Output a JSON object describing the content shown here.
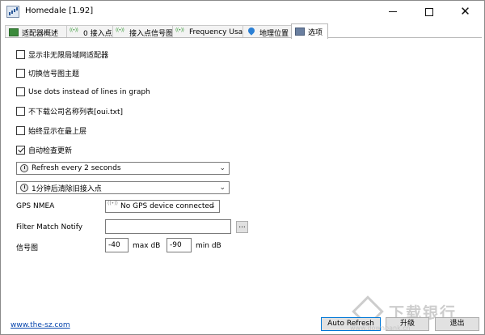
{
  "window": {
    "title": "Homedale [1.92]"
  },
  "tabs": [
    {
      "label": "适配器概述",
      "icon": "adapter-icon"
    },
    {
      "label": "0 接入点",
      "icon": "signal-icon"
    },
    {
      "label": "接入点信号图",
      "icon": "signal-icon"
    },
    {
      "label": "Frequency Usage",
      "icon": "signal-icon"
    },
    {
      "label": "地理位置",
      "icon": "pin-icon"
    },
    {
      "label": "选项",
      "icon": "options-icon",
      "active": true
    }
  ],
  "options": {
    "show_non_wlan": {
      "label": "显示非无限局域网适配器",
      "checked": false
    },
    "switch_theme": {
      "label": "切换信号图主题",
      "checked": false
    },
    "use_dots": {
      "label": "Use dots instead of lines in graph",
      "checked": false
    },
    "no_download_oui": {
      "label": "不下载公司名称列表[oui.txt]",
      "checked": false
    },
    "always_on_top": {
      "label": "始终显示在最上层",
      "checked": false
    },
    "auto_update": {
      "label": "自动检查更新",
      "checked": true
    }
  },
  "refresh_select": {
    "value": "Refresh every 2 seconds"
  },
  "clear_select": {
    "value": "1分钟后清除旧接入点"
  },
  "gps": {
    "label": "GPS NMEA",
    "value": "No GPS device connected"
  },
  "filter": {
    "label": "Filter Match Notify",
    "value": "",
    "browse_label": "..."
  },
  "signal_graph": {
    "label": "信号图",
    "max_value": "-40",
    "max_unit": "max dB",
    "min_value": "-90",
    "min_unit": "min dB"
  },
  "footer": {
    "link": "www.the-sz.com",
    "auto_refresh": "Auto Refresh",
    "upgrade": "升级",
    "exit": "退出"
  },
  "watermark": {
    "text": "下载银行",
    "url": "www.downbank.cn"
  }
}
